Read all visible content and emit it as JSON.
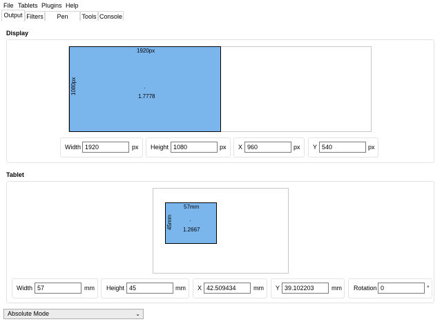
{
  "menu": {
    "items": [
      {
        "label": "File"
      },
      {
        "label": "Tablets"
      },
      {
        "label": "Plugins"
      },
      {
        "label": "Help"
      }
    ]
  },
  "tabs": [
    {
      "label": "Output",
      "active": true
    },
    {
      "label": "Filters",
      "active": false
    },
    {
      "label": "Pen Settings",
      "active": false
    },
    {
      "label": "Tools",
      "active": false
    },
    {
      "label": "Console",
      "active": false
    }
  ],
  "display": {
    "title": "Display",
    "area": {
      "width_label": "1920px",
      "height_label": "1080px",
      "center_marker": "·",
      "aspect": "1.7778"
    },
    "fields": [
      {
        "label": "Width",
        "value": "1920",
        "unit": "px"
      },
      {
        "label": "Height",
        "value": "1080",
        "unit": "px"
      },
      {
        "label": "X",
        "value": "960",
        "unit": "px"
      },
      {
        "label": "Y",
        "value": "540",
        "unit": "px"
      }
    ]
  },
  "tablet": {
    "title": "Tablet",
    "area": {
      "width_label": "57mm",
      "height_label": "45mm",
      "center_marker": "·",
      "aspect": "1.2667"
    },
    "fields": [
      {
        "label": "Width",
        "value": "57",
        "unit": "mm"
      },
      {
        "label": "Height",
        "value": "45",
        "unit": "mm"
      },
      {
        "label": "X",
        "value": "42.509434",
        "unit": "mm"
      },
      {
        "label": "Y",
        "value": "39.102203",
        "unit": "mm"
      },
      {
        "label": "Rotation",
        "value": "0",
        "unit": "°"
      }
    ]
  },
  "mode": {
    "selected": "Absolute Mode",
    "chevron": "⌄"
  },
  "colors": {
    "area_fill": "#7ab6ec",
    "border": "#c8c8c8"
  }
}
